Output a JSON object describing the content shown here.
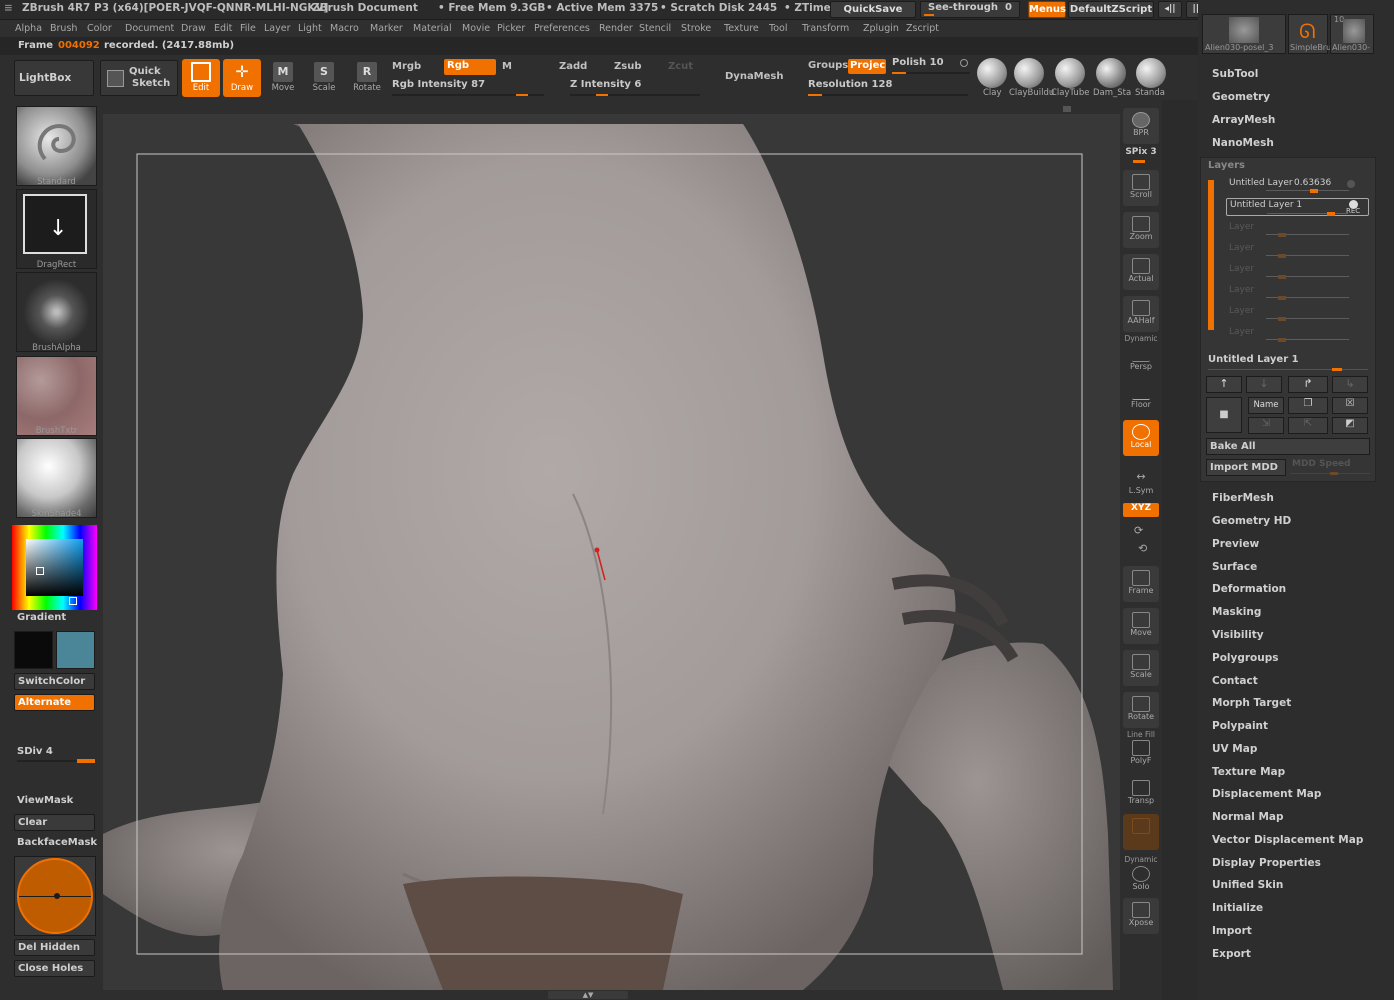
{
  "titlebar": {
    "app": "ZBrush 4R7 P3 (x64)[POER-JVQF-QNNR-MLHI-NGKV]",
    "document": "ZBrush Document",
    "free_mem": "• Free Mem 9.3GB",
    "active_mem": "• Active Mem 3375",
    "scratch_disk": "• Scratch Disk 2445",
    "ztime": "• ZTime",
    "quicksave": "QuickSave",
    "see_through": "See-through",
    "see_through_value": "0",
    "menus": "Menus",
    "default_zscript": "DefaultZScript"
  },
  "menubar": [
    "Alpha",
    "Brush",
    "Color",
    "Document",
    "Draw",
    "Edit",
    "File",
    "Layer",
    "Light",
    "Macro",
    "Marker",
    "Material",
    "Movie",
    "Picker",
    "Preferences",
    "Render",
    "Stencil",
    "Stroke",
    "Texture",
    "Tool",
    "Transform",
    "Zplugin",
    "Zscript"
  ],
  "infobar": {
    "frame_label": "Frame",
    "frame_number": "004092",
    "frame_status": "recorded. (2417.88mb)"
  },
  "toolbar": {
    "lightbox": "LightBox",
    "quick_sketch_1": "Quick",
    "quick_sketch_2": "Sketch",
    "edit": "Edit",
    "draw": "Draw",
    "move": "Move",
    "scale": "Scale",
    "rotate": "Rotate",
    "mrgb": "Mrgb",
    "rgb": "Rgb",
    "m": "M",
    "rgb_intensity": "Rgb Intensity 87",
    "rgb_intensity_value": 87,
    "zadd": "Zadd",
    "zsub": "Zsub",
    "zcut": "Zcut",
    "z_intensity": "Z Intensity 6",
    "z_intensity_value": 6,
    "dynamesh": "DynaMesh",
    "groups": "Groups",
    "project": "Projec",
    "polish": "Polish 10",
    "resolution": "Resolution 128",
    "brushes": [
      "Clay",
      "ClayBuildu",
      "ClayTube",
      "Dam_Sta",
      "Standa"
    ]
  },
  "lefttray": {
    "brush": "Standard",
    "stroke": "DragRect",
    "alpha": "BrushAlpha",
    "texture": "BrushTxtr",
    "material": "SkinShade4",
    "gradient": "Gradient",
    "switchcolor": "SwitchColor",
    "alternate": "Alternate",
    "sdiv": "SDiv 4",
    "viewmask": "ViewMask",
    "clear": "Clear",
    "backfacemask": "BackfaceMask",
    "del_hidden": "Del Hidden",
    "close_holes": "Close Holes"
  },
  "righttray": {
    "bpr": "BPR",
    "spix": "SPix 3",
    "buttons": [
      "Scroll",
      "Zoom",
      "Actual",
      "AAHalf",
      "Persp",
      "Floor",
      "Local",
      "L.Sym",
      "Frame",
      "Move",
      "Scale",
      "Rotate",
      "PolyF",
      "Transp",
      "Solo",
      "Xpose"
    ],
    "dynamic": "Dynamic",
    "line_fill": "Line Fill",
    "xyz": "XYZ"
  },
  "rightpanel": {
    "tool_thumbs": [
      "Alien030-posel_3",
      "SimpleBrush",
      "Alien030-"
    ],
    "tool_count": "10",
    "top_items": [
      "SubTool",
      "Geometry",
      "ArrayMesh",
      "NanoMesh"
    ],
    "layers_title": "Layers",
    "layer_rows": [
      {
        "name": "Untitled Layer",
        "value": "0.63636"
      },
      {
        "name": "Untitled Layer 1",
        "rec": "REC"
      },
      {
        "name": "Layer"
      },
      {
        "name": "Layer"
      },
      {
        "name": "Layer"
      },
      {
        "name": "Layer"
      },
      {
        "name": "Layer"
      },
      {
        "name": "Layer"
      }
    ],
    "selected_layer": "Untitled Layer 1",
    "name_button": "Name",
    "bake_all": "Bake All",
    "import_mdd": "Import MDD",
    "mdd_speed": "MDD Speed",
    "bottom_items": [
      "FiberMesh",
      "Geometry HD",
      "Preview",
      "Surface",
      "Deformation",
      "Masking",
      "Visibility",
      "Polygroups",
      "Contact",
      "Morph Target",
      "Polypaint",
      "UV Map",
      "Texture Map",
      "Displacement Map",
      "Normal Map",
      "Vector Displacement Map",
      "Display Properties",
      "Unified Skin",
      "Initialize",
      "Import",
      "Export"
    ]
  },
  "colors": {
    "accent": "#f07000",
    "panel": "#2e2e2e",
    "viewport": "#383838",
    "skin": "#a59d9b",
    "main_color": "#0a0a0a",
    "secondary_color": "#4a8598"
  }
}
